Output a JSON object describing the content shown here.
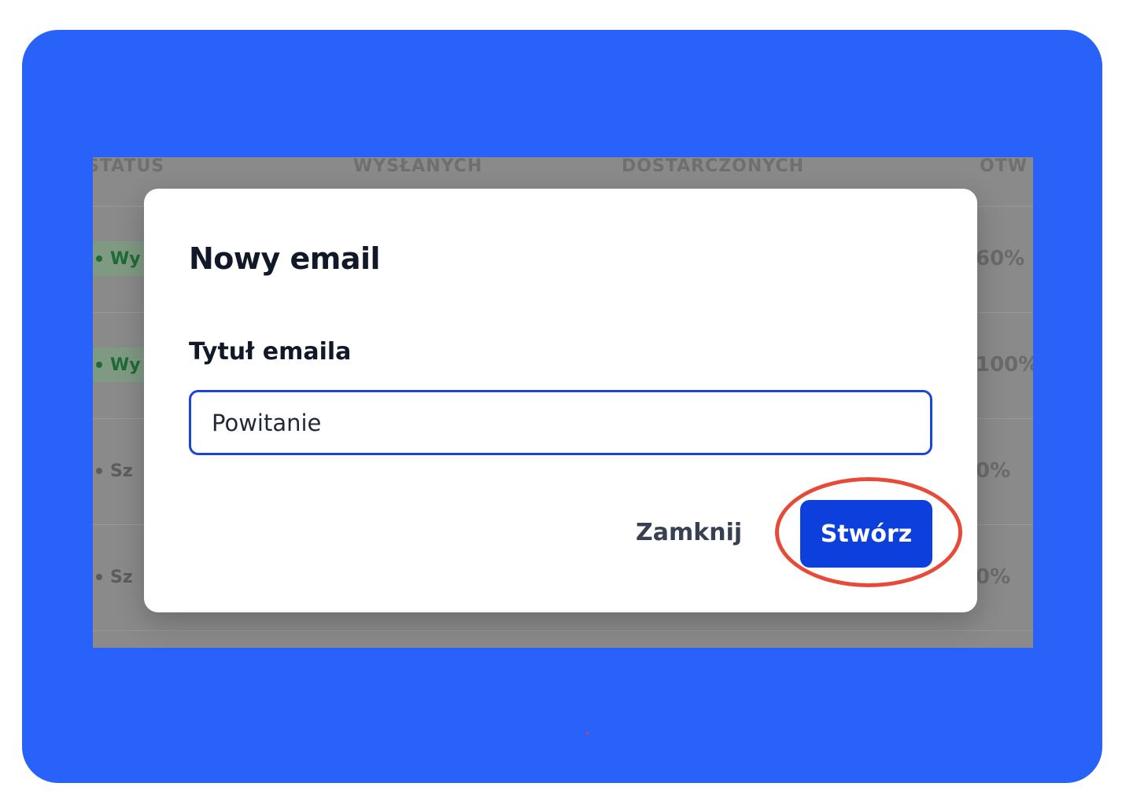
{
  "table": {
    "headers": [
      "STATUS",
      "WYSŁANYCH",
      "DOSTARCZONYCH",
      "OTW"
    ],
    "rows": [
      {
        "status": "Wy",
        "status_color": "green",
        "percent": "60%"
      },
      {
        "status": "Wy",
        "status_color": "green",
        "percent": "100%"
      },
      {
        "status": "Sz",
        "status_color": "gray",
        "percent": "0%"
      },
      {
        "status": "Sz",
        "status_color": "gray",
        "percent": "0%"
      }
    ]
  },
  "modal": {
    "title": "Nowy email",
    "field_label": "Tytuł emaila",
    "field_value": "Powitanie",
    "close_label": "Zamknij",
    "create_label": "Stwórz"
  },
  "colors": {
    "frame_background": "#2962f9",
    "primary_button": "#0c3fdc",
    "input_border": "#1b44d9",
    "highlight_ring": "#e84a3a",
    "status_green": "#1f6b36"
  }
}
